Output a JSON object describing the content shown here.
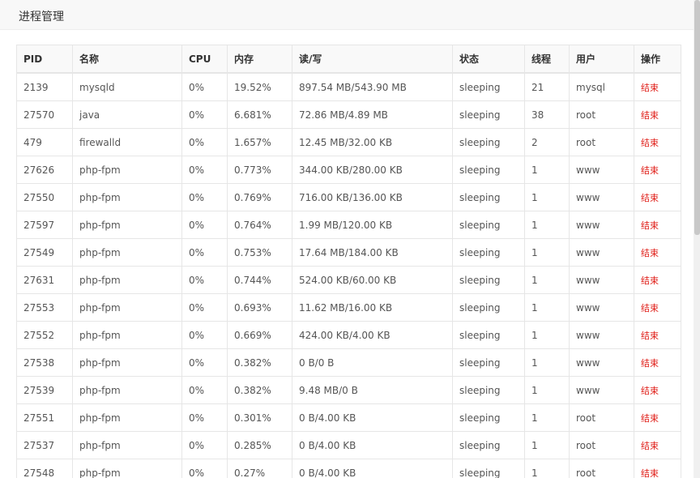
{
  "dialog": {
    "title": "进程管理"
  },
  "table": {
    "headers": {
      "pid": "PID",
      "name": "名称",
      "cpu": "CPU",
      "mem": "内存",
      "io": "读/写",
      "state": "状态",
      "threads": "线程",
      "user": "用户",
      "action": "操作"
    },
    "rows": [
      {
        "pid": "2139",
        "name": "mysqld",
        "cpu": "0%",
        "mem": "19.52%",
        "io": "897.54 MB/543.90 MB",
        "state": "sleeping",
        "threads": "21",
        "user": "mysql",
        "action": "结束"
      },
      {
        "pid": "27570",
        "name": "java",
        "cpu": "0%",
        "mem": "6.681%",
        "io": "72.86 MB/4.89 MB",
        "state": "sleeping",
        "threads": "38",
        "user": "root",
        "action": "结束"
      },
      {
        "pid": "479",
        "name": "firewalld",
        "cpu": "0%",
        "mem": "1.657%",
        "io": "12.45 MB/32.00 KB",
        "state": "sleeping",
        "threads": "2",
        "user": "root",
        "action": "结束"
      },
      {
        "pid": "27626",
        "name": "php-fpm",
        "cpu": "0%",
        "mem": "0.773%",
        "io": "344.00 KB/280.00 KB",
        "state": "sleeping",
        "threads": "1",
        "user": "www",
        "action": "结束"
      },
      {
        "pid": "27550",
        "name": "php-fpm",
        "cpu": "0%",
        "mem": "0.769%",
        "io": "716.00 KB/136.00 KB",
        "state": "sleeping",
        "threads": "1",
        "user": "www",
        "action": "结束"
      },
      {
        "pid": "27597",
        "name": "php-fpm",
        "cpu": "0%",
        "mem": "0.764%",
        "io": "1.99 MB/120.00 KB",
        "state": "sleeping",
        "threads": "1",
        "user": "www",
        "action": "结束"
      },
      {
        "pid": "27549",
        "name": "php-fpm",
        "cpu": "0%",
        "mem": "0.753%",
        "io": "17.64 MB/184.00 KB",
        "state": "sleeping",
        "threads": "1",
        "user": "www",
        "action": "结束"
      },
      {
        "pid": "27631",
        "name": "php-fpm",
        "cpu": "0%",
        "mem": "0.744%",
        "io": "524.00 KB/60.00 KB",
        "state": "sleeping",
        "threads": "1",
        "user": "www",
        "action": "结束"
      },
      {
        "pid": "27553",
        "name": "php-fpm",
        "cpu": "0%",
        "mem": "0.693%",
        "io": "11.62 MB/16.00 KB",
        "state": "sleeping",
        "threads": "1",
        "user": "www",
        "action": "结束"
      },
      {
        "pid": "27552",
        "name": "php-fpm",
        "cpu": "0%",
        "mem": "0.669%",
        "io": "424.00 KB/4.00 KB",
        "state": "sleeping",
        "threads": "1",
        "user": "www",
        "action": "结束"
      },
      {
        "pid": "27538",
        "name": "php-fpm",
        "cpu": "0%",
        "mem": "0.382%",
        "io": "0 B/0 B",
        "state": "sleeping",
        "threads": "1",
        "user": "www",
        "action": "结束"
      },
      {
        "pid": "27539",
        "name": "php-fpm",
        "cpu": "0%",
        "mem": "0.382%",
        "io": "9.48 MB/0 B",
        "state": "sleeping",
        "threads": "1",
        "user": "www",
        "action": "结束"
      },
      {
        "pid": "27551",
        "name": "php-fpm",
        "cpu": "0%",
        "mem": "0.301%",
        "io": "0 B/4.00 KB",
        "state": "sleeping",
        "threads": "1",
        "user": "root",
        "action": "结束"
      },
      {
        "pid": "27537",
        "name": "php-fpm",
        "cpu": "0%",
        "mem": "0.285%",
        "io": "0 B/4.00 KB",
        "state": "sleeping",
        "threads": "1",
        "user": "root",
        "action": "结束"
      },
      {
        "pid": "27548",
        "name": "php-fpm",
        "cpu": "0%",
        "mem": "0.27%",
        "io": "0 B/4.00 KB",
        "state": "sleeping",
        "threads": "1",
        "user": "root",
        "action": "结束"
      }
    ]
  },
  "colors": {
    "kill_link": "#e0201a",
    "header_bg": "#f8f8f8",
    "border": "#e6e6e6"
  }
}
